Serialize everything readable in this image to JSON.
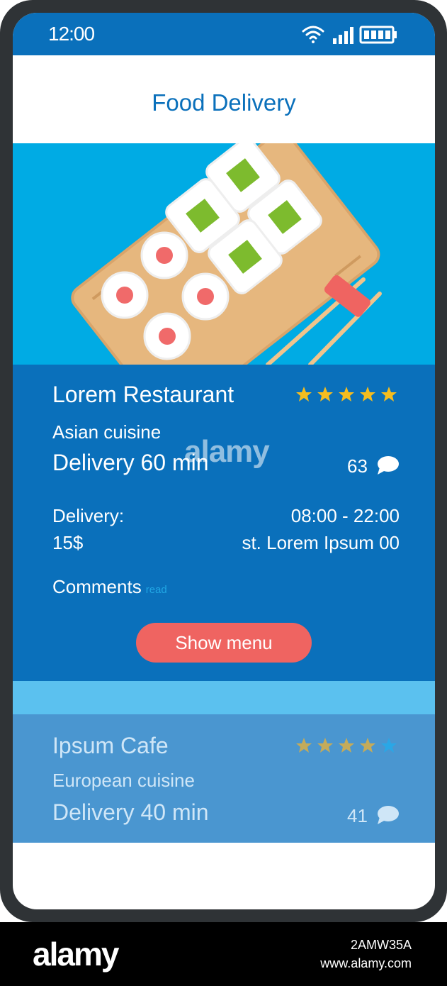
{
  "status_bar": {
    "time": "12:00"
  },
  "app": {
    "title": "Food Delivery"
  },
  "restaurants": [
    {
      "name": "Lorem Restaurant",
      "rating": 5,
      "cuisine": "Asian cuisine",
      "delivery_time": "Delivery 60 min",
      "comment_count": "63",
      "delivery_label": "Delivery:",
      "hours": "08:00 - 22:00",
      "price": "15$",
      "address": "st. Lorem Ipsum 00",
      "comments_label": "Comments",
      "read_link": "read",
      "button_label": "Show menu"
    },
    {
      "name": "Ipsum Cafe",
      "rating": 4,
      "cuisine": "European cuisine",
      "delivery_time": "Delivery 40 min",
      "comment_count": "41"
    }
  ],
  "colors": {
    "primary": "#0a70bb",
    "hero": "#00abe4",
    "accent": "#ef6461",
    "star": "#f5bd1f"
  },
  "watermark": {
    "text": "alamy",
    "image_id": "2AMW35A",
    "url": "www.alamy.com"
  }
}
